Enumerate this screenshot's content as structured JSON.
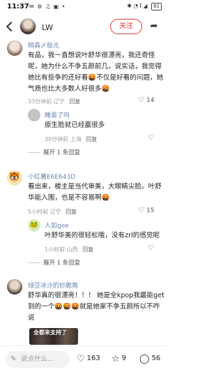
{
  "status_bar": {
    "time": "11:37",
    "left_icons": "✉ ⚙ ♫ ▣ •",
    "right_icons": "✱ ◔ 𝄃 ◢",
    "battery": "81"
  },
  "header": {
    "username": "LW",
    "follow_label": "关注",
    "share_icon": "share-icon"
  },
  "comments": [
    {
      "username": "棋森〆极光",
      "text": "有品，我一直想说叶舒华很漂亮，我还奇怪呢，她为什么不争五颜前几，说实话，我觉得她比有些争的还好看🤬不仅是好看的问题，她气质也比大多数人好很多🤬",
      "meta": "33分钟前 辽宁",
      "reply_label": "回复",
      "likes": "14",
      "avatar_color": "#d6c3b6"
    },
    {
      "username": "睡虽了吗",
      "text": "原生脸就已经赢很多",
      "meta": "30分钟前 上海",
      "reply_label": "回复",
      "likes": "",
      "avatar_color": "#b9b9b9",
      "expand": "展开 1 条回复"
    },
    {
      "username": "小红薯E6E643D",
      "text": "看出来，棱主是当代审美，大眼睛尖脸。叶舒华能入围，也是不容易啊🤬",
      "meta": "5小时前 辽宁",
      "reply_label": "回复",
      "likes": "15",
      "avatar_color": "#e8b563"
    },
    {
      "username": "人如gee",
      "text": "叶舒华美的很轻松哦，没有zrl的感觉呢",
      "meta": "1小时前 山西",
      "reply_label": "回复",
      "likes": "",
      "avatar_color": "#c9e0a4",
      "expand": "展开 1 条回复"
    },
    {
      "username": "绿豆冰沙的妙脆角",
      "text": "舒华真的很漂亮！！！ 她是全kpop我最能get到的一个🤬🤬🤬就是她家不争五颜所以不咋说",
      "meta": "",
      "reply_label": "",
      "likes": "",
      "avatar_color": "#9b8f86",
      "image_caption": "全都来支持了"
    }
  ],
  "bottom_bar": {
    "input_placeholder": "说点什么...",
    "likes": "163",
    "favorites": "9",
    "comments": "56"
  }
}
